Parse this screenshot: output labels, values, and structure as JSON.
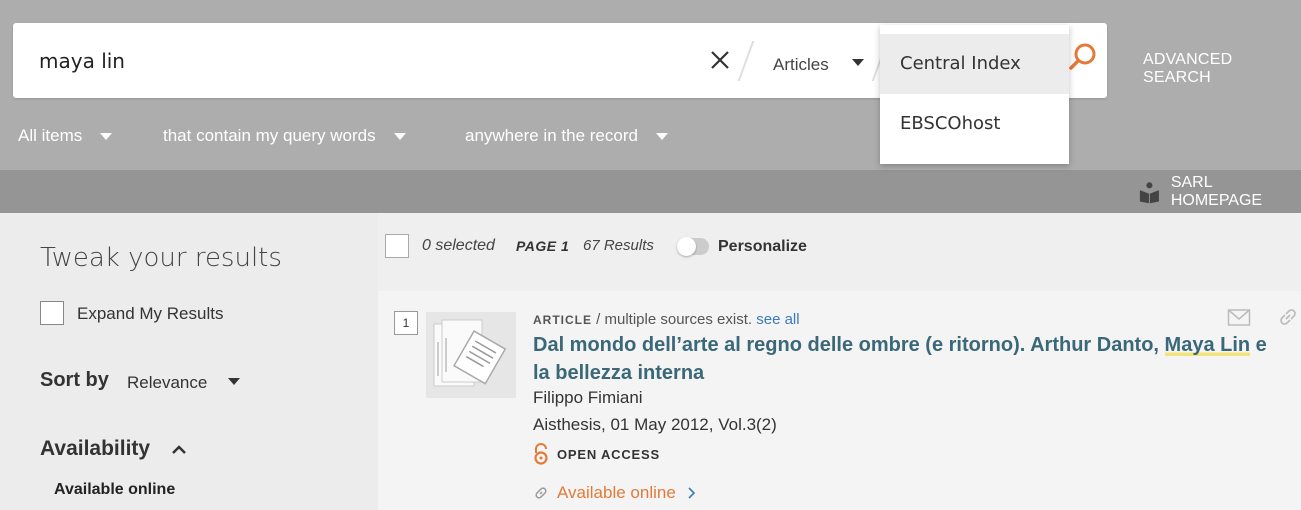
{
  "search": {
    "query": "maya lin",
    "scope_label": "Articles",
    "dropdown_options": [
      "Central Index",
      "EBSCOhost"
    ],
    "advanced_search_label": "ADVANCED SEARCH"
  },
  "filters": {
    "items_label": "All items",
    "match_label": "that contain my query words",
    "field_label": "anywhere in the record"
  },
  "homepage_label": "SARL HOMEPAGE",
  "sidebar": {
    "title": "Tweak your results",
    "expand_label": "Expand My Results",
    "sort_by_label": "Sort by",
    "sort_by_value": "Relevance",
    "availability_title": "Availability",
    "availability_option": "Available online"
  },
  "results_header": {
    "selected_text": "0 selected",
    "page_label": "PAGE 1",
    "results_count": "67 Results",
    "personalize_label": "Personalize"
  },
  "result": {
    "number": "1",
    "type": "ARTICLE",
    "sources_text": " / multiple sources exist. ",
    "see_all": "see all",
    "title_before": "Dal mondo dell’arte al regno delle ombre (e ritorno). Arthur Danto, ",
    "title_highlight": "Maya Lin",
    "title_after": " e la bellezza interna",
    "author": "Filippo Fimiani",
    "source": "Aisthesis, 01 May 2012, Vol.3(2)",
    "access": "OPEN ACCESS",
    "availability": "Available online"
  },
  "colors": {
    "top_bar": "#adadad",
    "band": "#959595",
    "accent_orange": "#e47a3a",
    "title_teal": "#3a6878",
    "link_blue": "#3a7bb8"
  }
}
